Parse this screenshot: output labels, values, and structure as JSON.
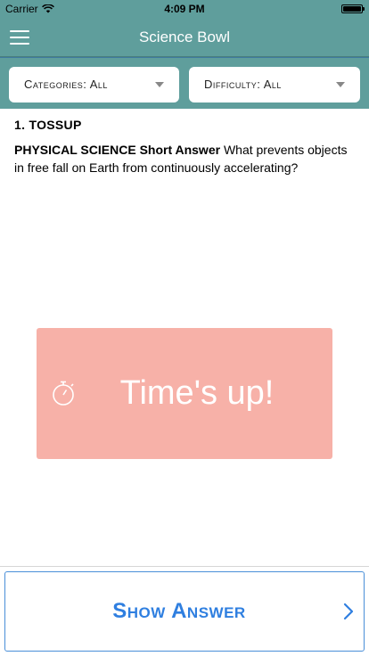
{
  "status_bar": {
    "carrier": "Carrier",
    "time": "4:09 PM",
    "wifi_icon": "wifi-icon",
    "battery_icon": "battery-icon"
  },
  "nav": {
    "title": "Science Bowl",
    "menu_icon": "hamburger-menu-icon"
  },
  "filters": {
    "categories_label": "Categories: All",
    "difficulty_label": "Difficulty: All",
    "caret_icon": "caret-down-icon"
  },
  "question": {
    "number_label": "1. TOSSUP",
    "category": "PHYSICAL SCIENCE",
    "answer_type": "Short Answer",
    "text": "What prevents objects in free fall on Earth from continuously accelerating?"
  },
  "timer": {
    "message": "Time's up!",
    "icon": "stopwatch-icon",
    "color": "#f7b1a8"
  },
  "actions": {
    "show_answer_label": "Show Answer",
    "chevron_icon": "chevron-right-icon"
  },
  "colors": {
    "nav_bg": "#5f9e9c",
    "accent_blue": "#2f7fe0"
  }
}
